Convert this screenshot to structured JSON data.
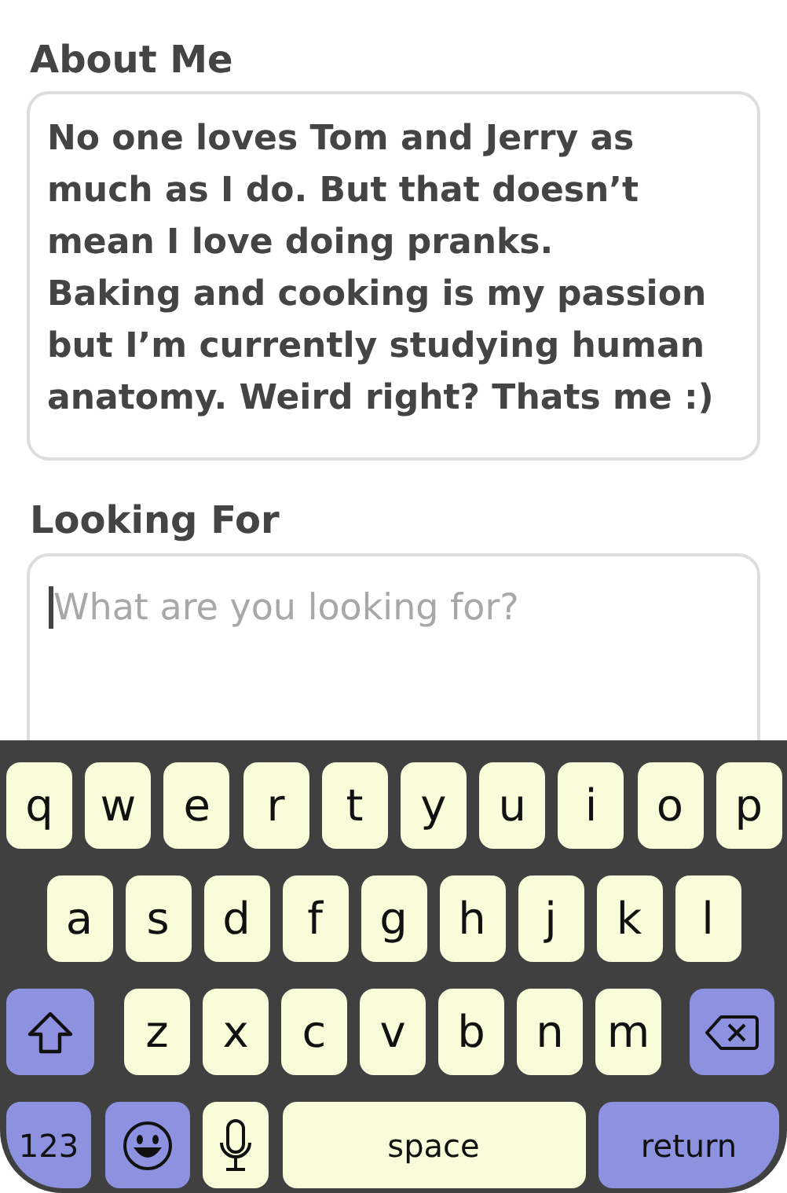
{
  "about_me": {
    "label": "About Me",
    "value": "No one loves Tom and Jerry as much as I do. But that doesn’t mean I love doing pranks.\nBaking and cooking is my passion but I’m currently studying human anatomy. Weird right? Thats me :)"
  },
  "looking_for": {
    "label": "Looking For",
    "placeholder": "What are you looking for?",
    "focused": true
  },
  "keyboard": {
    "rows": [
      {
        "keys": [
          {
            "kind": "letter",
            "label": "q"
          },
          {
            "kind": "letter",
            "label": "w"
          },
          {
            "kind": "letter",
            "label": "e"
          },
          {
            "kind": "letter",
            "label": "r"
          },
          {
            "kind": "letter",
            "label": "t"
          },
          {
            "kind": "letter",
            "label": "y"
          },
          {
            "kind": "letter",
            "label": "u"
          },
          {
            "kind": "letter",
            "label": "i"
          },
          {
            "kind": "letter",
            "label": "o"
          },
          {
            "kind": "letter",
            "label": "p"
          }
        ]
      },
      {
        "keys": [
          {
            "kind": "letter",
            "label": "a"
          },
          {
            "kind": "letter",
            "label": "s"
          },
          {
            "kind": "letter",
            "label": "d"
          },
          {
            "kind": "letter",
            "label": "f"
          },
          {
            "kind": "letter",
            "label": "g"
          },
          {
            "kind": "letter",
            "label": "h"
          },
          {
            "kind": "letter",
            "label": "j"
          },
          {
            "kind": "letter",
            "label": "k"
          },
          {
            "kind": "letter",
            "label": "l"
          }
        ]
      },
      {
        "keys": [
          {
            "kind": "shift"
          },
          {
            "kind": "letter",
            "label": "z"
          },
          {
            "kind": "letter",
            "label": "x"
          },
          {
            "kind": "letter",
            "label": "c"
          },
          {
            "kind": "letter",
            "label": "v"
          },
          {
            "kind": "letter",
            "label": "b"
          },
          {
            "kind": "letter",
            "label": "n"
          },
          {
            "kind": "letter",
            "label": "m"
          },
          {
            "kind": "delete"
          }
        ]
      },
      {
        "keys": [
          {
            "kind": "numbers",
            "label": "123"
          },
          {
            "kind": "emoji"
          },
          {
            "kind": "mic"
          },
          {
            "kind": "space",
            "label": "space"
          },
          {
            "kind": "return",
            "label": "return"
          }
        ]
      }
    ]
  }
}
